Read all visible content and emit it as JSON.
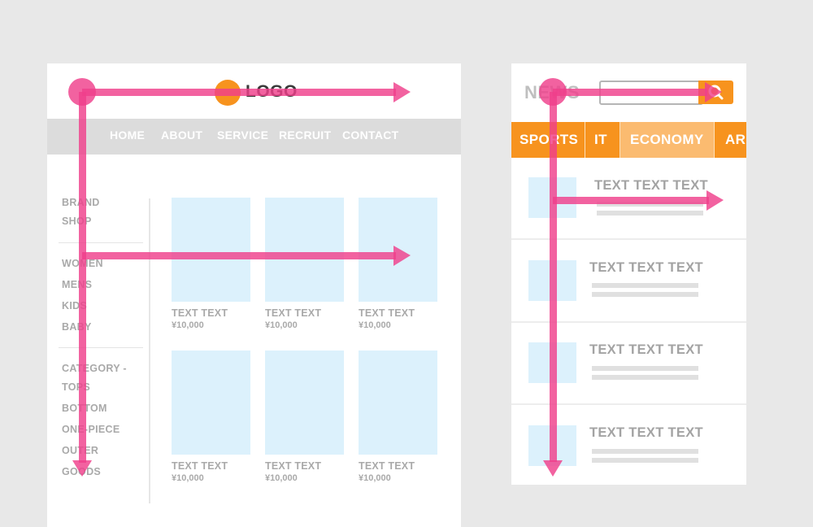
{
  "colors": {
    "background": "#e8e8e8",
    "accent_orange": "#f7931e",
    "flow_arrow": "#ef3f8b",
    "placeholder_image": "#dcf1fc"
  },
  "shop": {
    "logo": "LOGO",
    "nav": [
      "HOME",
      "ABOUT",
      "SERVICE",
      "RECRUIT",
      "CONTACT"
    ],
    "sidebar": {
      "brand": [
        "BRAND",
        "SHOP"
      ],
      "genders": [
        "WOMEN",
        "MENS",
        "KIDS",
        "BABY"
      ],
      "category_heading": "CATEGORY -",
      "categories": [
        "TOPS",
        "BOTTOM",
        "ONE-PIECE",
        "OUTER",
        "GOODS"
      ]
    },
    "products": [
      {
        "title": "TEXT TEXT",
        "price": "¥10,000"
      },
      {
        "title": "TEXT TEXT",
        "price": "¥10,000"
      },
      {
        "title": "TEXT TEXT",
        "price": "¥10,000"
      },
      {
        "title": "TEXT TEXT",
        "price": "¥10,000"
      },
      {
        "title": "TEXT TEXT",
        "price": "¥10,000"
      },
      {
        "title": "TEXT TEXT",
        "price": "¥10,000"
      }
    ]
  },
  "news": {
    "title": "NEWS",
    "search_icon": "search-icon",
    "tabs": [
      "SPORTS",
      "IT",
      "ECONOMY",
      "AR"
    ],
    "active_tab": "ECONOMY",
    "articles": [
      {
        "title": "TEXT TEXT TEXT"
      },
      {
        "title": "TEXT TEXT TEXT"
      },
      {
        "title": "TEXT TEXT TEXT"
      },
      {
        "title": "TEXT TEXT TEXT"
      }
    ]
  }
}
